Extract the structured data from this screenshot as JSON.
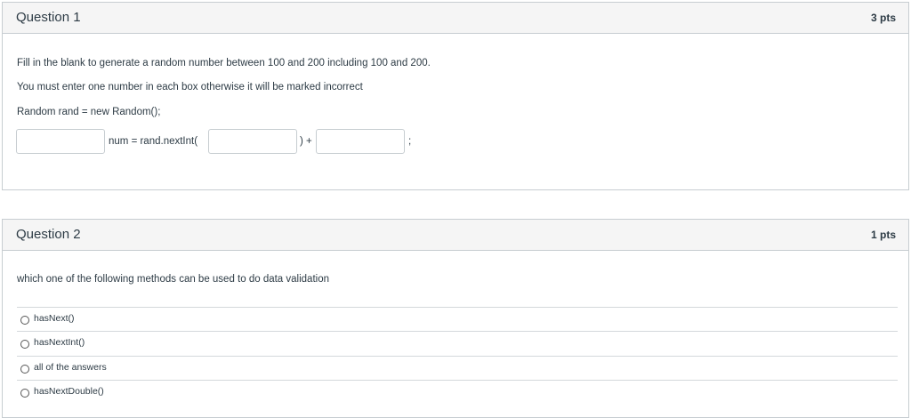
{
  "q1": {
    "title": "Question 1",
    "points": "3 pts",
    "line1": "Fill in the blank to generate a random number between 100 and 200 including 100 and 200.",
    "line2": "You must enter one number in each box otherwise it will be marked incorrect",
    "line3": "Random rand = new Random();",
    "code_mid": "num = rand.nextInt(",
    "code_plus": ") +",
    "code_end": ";",
    "inputs": [
      "",
      "",
      ""
    ]
  },
  "q2": {
    "title": "Question 2",
    "points": "1 pts",
    "prompt": "which one of the following methods can be used to do data validation",
    "options": [
      "hasNext()",
      "hasNextInt()",
      "all of the answers",
      "hasNextDouble()"
    ]
  }
}
